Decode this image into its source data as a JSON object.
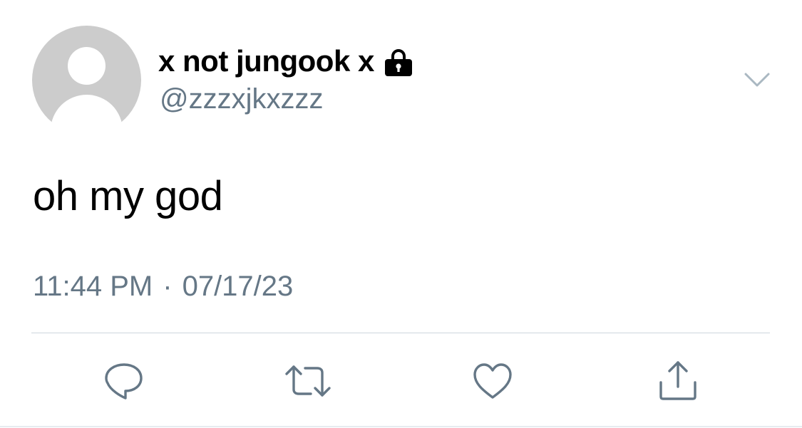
{
  "user": {
    "display_name": "x not jungook x",
    "handle": "@zzzxjkxzzz",
    "protected_icon": "lock-icon"
  },
  "tweet": {
    "text": "oh my god",
    "time": "11:44 PM",
    "separator": "·",
    "date": "07/17/23"
  },
  "actions": [
    {
      "name": "reply",
      "icon": "speech-bubble-icon"
    },
    {
      "name": "retweet",
      "icon": "retweet-arrows-icon"
    },
    {
      "name": "like",
      "icon": "heart-icon"
    },
    {
      "name": "share",
      "icon": "share-upload-icon"
    }
  ],
  "menu": {
    "icon": "chevron-down-icon"
  },
  "colors": {
    "text_primary": "#000000",
    "text_secondary": "#657786",
    "icon_gray": "#657786",
    "avatar_bg": "#cccccc",
    "divider": "#cdd6dd",
    "caret": "#aab8c2"
  }
}
